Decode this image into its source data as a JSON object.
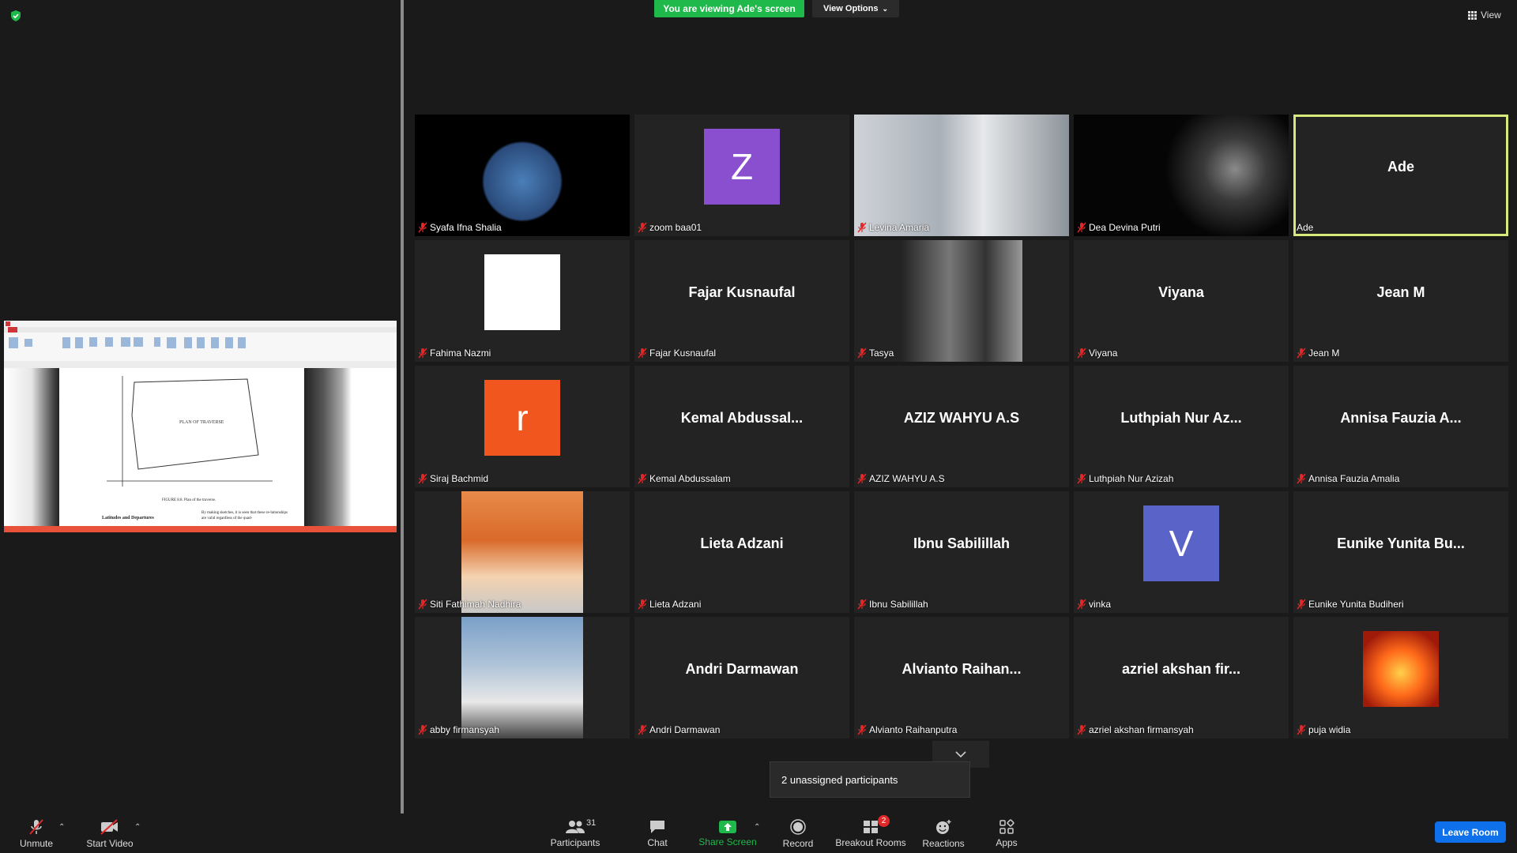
{
  "banner": {
    "viewing_text": "You are viewing Ade's screen",
    "view_options_label": "View Options"
  },
  "top_right": {
    "view_label": "View"
  },
  "colors": {
    "accent_green": "#1fb84a",
    "active_speaker": "#d8e87a",
    "muted_red": "#e02828",
    "leave_blue": "#0e71eb"
  },
  "participants": [
    {
      "name": "Syafa Ifna Shalia",
      "display": "",
      "kind": "video"
    },
    {
      "name": "zoom baa01",
      "display": "",
      "kind": "letter",
      "letter": "Z",
      "color": "#8a4fcf"
    },
    {
      "name": "Levina Amaria",
      "display": "",
      "kind": "video"
    },
    {
      "name": "Dea Devina Putri",
      "display": "",
      "kind": "video"
    },
    {
      "name": "Ade",
      "display": "Ade",
      "kind": "name"
    },
    {
      "name": "Fahima Nazmi",
      "display": "",
      "kind": "picture"
    },
    {
      "name": "Fajar Kusnaufal",
      "display": "Fajar Kusnaufal",
      "kind": "name"
    },
    {
      "name": "Tasya",
      "display": "",
      "kind": "picture"
    },
    {
      "name": "Viyana",
      "display": "Viyana",
      "kind": "name"
    },
    {
      "name": "Jean M",
      "display": "Jean M",
      "kind": "name"
    },
    {
      "name": "Siraj Bachmid",
      "display": "",
      "kind": "letter",
      "letter": "r",
      "color": "#f0561d"
    },
    {
      "name": "Kemal Abdussalam",
      "display": "Kemal  Abdussal...",
      "kind": "name"
    },
    {
      "name": "AZIZ WAHYU A.S",
      "display": "AZIZ WAHYU A.S",
      "kind": "name"
    },
    {
      "name": "Luthpiah Nur Azizah",
      "display": "Luthpiah Nur Az...",
      "kind": "name"
    },
    {
      "name": "Annisa Fauzia Amalia",
      "display": "Annisa  Fauzia  A...",
      "kind": "name"
    },
    {
      "name": "Siti Fathimah Nadhira",
      "display": "",
      "kind": "picture"
    },
    {
      "name": "Lieta Adzani",
      "display": "Lieta Adzani",
      "kind": "name"
    },
    {
      "name": "Ibnu Sabilillah",
      "display": "Ibnu Sabilillah",
      "kind": "name"
    },
    {
      "name": "vinka",
      "display": "",
      "kind": "letter",
      "letter": "V",
      "color": "#5a64c8"
    },
    {
      "name": "Eunike Yunita Budiheri",
      "display": "Eunike  Yunita  Bu...",
      "kind": "name"
    },
    {
      "name": "abby firmansyah",
      "display": "",
      "kind": "picture"
    },
    {
      "name": "Andri Darmawan",
      "display": "Andri Darmawan",
      "kind": "name"
    },
    {
      "name": "Alvianto Raihanputra",
      "display": "Alvianto  Raihan...",
      "kind": "name"
    },
    {
      "name": "azriel akshan firmansyah",
      "display": "azriel  akshan  fir...",
      "kind": "name"
    },
    {
      "name": "puja widia",
      "display": "",
      "kind": "picture"
    }
  ],
  "unassigned": {
    "text": "2 unassigned participants"
  },
  "toolbar": {
    "unmute": "Unmute",
    "start_video": "Start Video",
    "participants": "Participants",
    "participants_count": "31",
    "chat": "Chat",
    "share_screen": "Share Screen",
    "record": "Record",
    "breakout_rooms": "Breakout Rooms",
    "breakout_badge": "2",
    "reactions": "Reactions",
    "apps": "Apps",
    "leave_room": "Leave Room"
  },
  "shared_screen": {
    "figure_title": "PLAN OF TRAVERSE",
    "figure_caption": "FIGURE 8.8.  Plan of the traverse.",
    "section_heading": "Latitudes and Departures",
    "body_text": "By making sketches, it is seen that these re-lationships are valid regardless of the quad-"
  }
}
